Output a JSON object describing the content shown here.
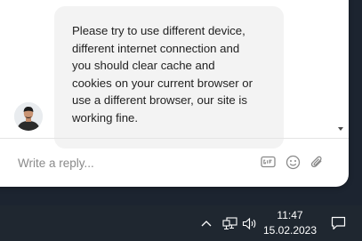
{
  "chat": {
    "agent_message": "Please try to use different device, different internet connection and you should clear cache and cookies on your current browser or use a different browser, our site is working fine.",
    "agent_message_lines": [
      "Please try to use different device,",
      "different internet connection and",
      "you should clear cache and",
      "cookies on your current browser or",
      "use a different browser, our site is",
      "working fine."
    ],
    "avatar_icon": "agent-avatar"
  },
  "composer": {
    "placeholder": "Write a reply...",
    "icons": [
      "gif-icon",
      "emoji-icon",
      "attachment-icon"
    ]
  },
  "taskbar": {
    "time": "11:47",
    "date": "15.02.2023",
    "tray_icons": [
      "chevron-up-icon",
      "network-icon",
      "volume-icon",
      "notification-icon"
    ]
  },
  "colors": {
    "page_background": "#1c2430",
    "bubble": "#f3f3f3",
    "taskbar": "#1f2730",
    "icon_gray": "#8a8a8a"
  }
}
